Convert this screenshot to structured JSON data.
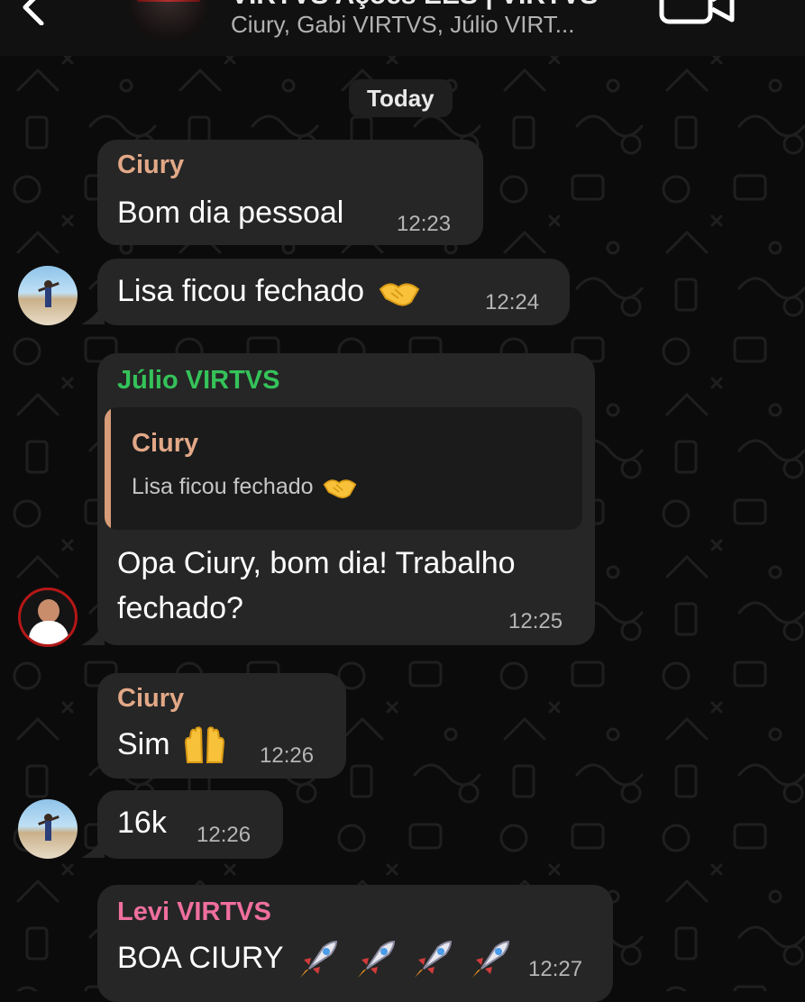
{
  "header": {
    "title": "VIRTVS Ações EES | VIRTVS",
    "members": "Ciury, Gabi VIRTVS, Júlio VIRT..."
  },
  "date_divider": "Today",
  "colors": {
    "background": "#0b0b0b",
    "bubble": "#262626",
    "sender_ciury": "#e2a887",
    "sender_julio": "#35c25a",
    "sender_levi": "#ef6f9e",
    "timestamp": "#b5b5b5"
  },
  "messages": [
    {
      "sender": "Ciury",
      "text": "Bom dia pessoal",
      "time": "12:23"
    },
    {
      "text": "Lisa ficou fechado",
      "emoji": "handshake-icon",
      "time": "12:24"
    },
    {
      "sender": "Júlio VIRTVS",
      "reply": {
        "sender": "Ciury",
        "text": "Lisa ficou fechado",
        "emoji": "handshake-icon"
      },
      "text_line1": "Opa Ciury, bom dia! Trabalho",
      "text_line2": "fechado?",
      "time": "12:25"
    },
    {
      "sender": "Ciury",
      "text": "Sim",
      "emoji": "raising-hands-icon",
      "time": "12:26"
    },
    {
      "text": "16k",
      "time": "12:26"
    },
    {
      "sender": "Levi VIRTVS",
      "text": "BOA CIURY",
      "emoji": "rocket-icon",
      "emoji_count": 4,
      "time": "12:27"
    }
  ]
}
